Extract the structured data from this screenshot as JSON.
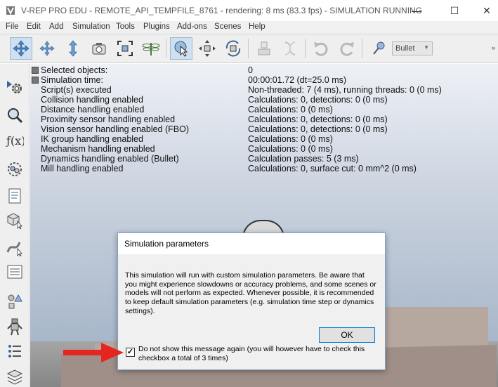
{
  "window": {
    "title": "V-REP PRO EDU - REMOTE_API_TEMPFILE_8761 - rendering: 8 ms (83.3 fps) - SIMULATION RUNNING",
    "minimize": "—",
    "maximize": "☐",
    "close": "✕"
  },
  "menu": [
    "File",
    "Edit",
    "Add",
    "Simulation",
    "Tools",
    "Plugins",
    "Add-ons",
    "Scenes",
    "Help"
  ],
  "toolbar": {
    "buttons": [
      "camera-pan",
      "camera-rotate",
      "camera-shift",
      "camera-opening-angle",
      "fit-to-view",
      "manipulate-camera",
      "click-selection",
      "object-shift",
      "object-rotate",
      "assemble",
      "transfer-dna",
      "undo",
      "redo",
      "physics-engine"
    ],
    "engine_value": "Bullet",
    "end_glyph": "»"
  },
  "info": [
    {
      "label": "Selected objects:",
      "value": "0"
    },
    {
      "label": "Simulation time:",
      "value": "00:00:01.72 (dt=25.0 ms)"
    },
    {
      "label": "Script(s) executed",
      "value": "Non-threaded: 7 (4 ms), running threads: 0 (0 ms)"
    },
    {
      "label": "Collision handling enabled",
      "value": "Calculations: 0, detections: 0 (0 ms)"
    },
    {
      "label": "Distance handling enabled",
      "value": "Calculations: 0 (0 ms)"
    },
    {
      "label": "Proximity sensor handling enabled",
      "value": "Calculations: 0, detections: 0 (0 ms)"
    },
    {
      "label": "Vision sensor handling enabled (FBO)",
      "value": "Calculations: 0, detections: 0 (0 ms)"
    },
    {
      "label": "IK group handling enabled",
      "value": "Calculations: 0 (0 ms)"
    },
    {
      "label": "Mechanism handling enabled",
      "value": "Calculations: 0 (0 ms)"
    },
    {
      "label": "Dynamics handling enabled (Bullet)",
      "value": "Calculation passes: 5 (3 ms)"
    },
    {
      "label": "Mill handling enabled",
      "value": "Calculations: 0, surface cut: 0 mm^2 (0 ms)"
    }
  ],
  "dialog": {
    "title": "Simulation parameters",
    "message": "This simulation will run with custom simulation parameters. Be aware that you might experience slowdowns or accuracy problems, and some scenes or models will not perform as expected. Whenever possible, it is recommended to keep default simulation parameters (e.g. simulation time step or dynamics settings).",
    "ok_label": "OK",
    "checkbox_mark": "✓",
    "checkbox_label": "Do not show this message again (you will however have to check this checkbox a total of 3 times)",
    "checkbox_checked": true
  },
  "colors": {
    "accent": "#0078d7",
    "annotation_arrow": "#e52620",
    "active_tool": "#cfe0f1"
  }
}
